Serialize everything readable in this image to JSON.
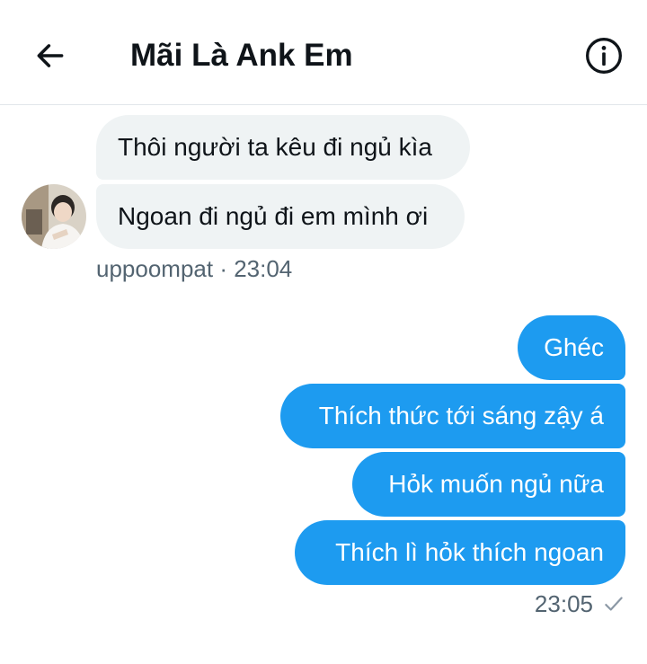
{
  "header": {
    "title": "Mãi Là Ank Em",
    "back_icon": "arrow-left-icon",
    "info_icon": "info-circle-icon"
  },
  "received": {
    "messages": [
      "Thôi người ta kêu đi ngủ kìa",
      "Ngoan đi ngủ đi em mình ơi"
    ],
    "meta": "uppoompat · 23:04",
    "avatar_icon": "user-avatar"
  },
  "sent": {
    "messages": [
      "Ghéc",
      "Thích thức tới sáng zậy á",
      "Hỏk muốn ngủ nữa",
      "Thích lì hỏk thích ngoan"
    ],
    "time": "23:05",
    "status_icon": "checkmark-icon"
  },
  "colors": {
    "accent": "#1d9bf0",
    "received_bubble": "#eff3f4",
    "meta_text": "#536471",
    "divider": "#e1e6ea"
  }
}
